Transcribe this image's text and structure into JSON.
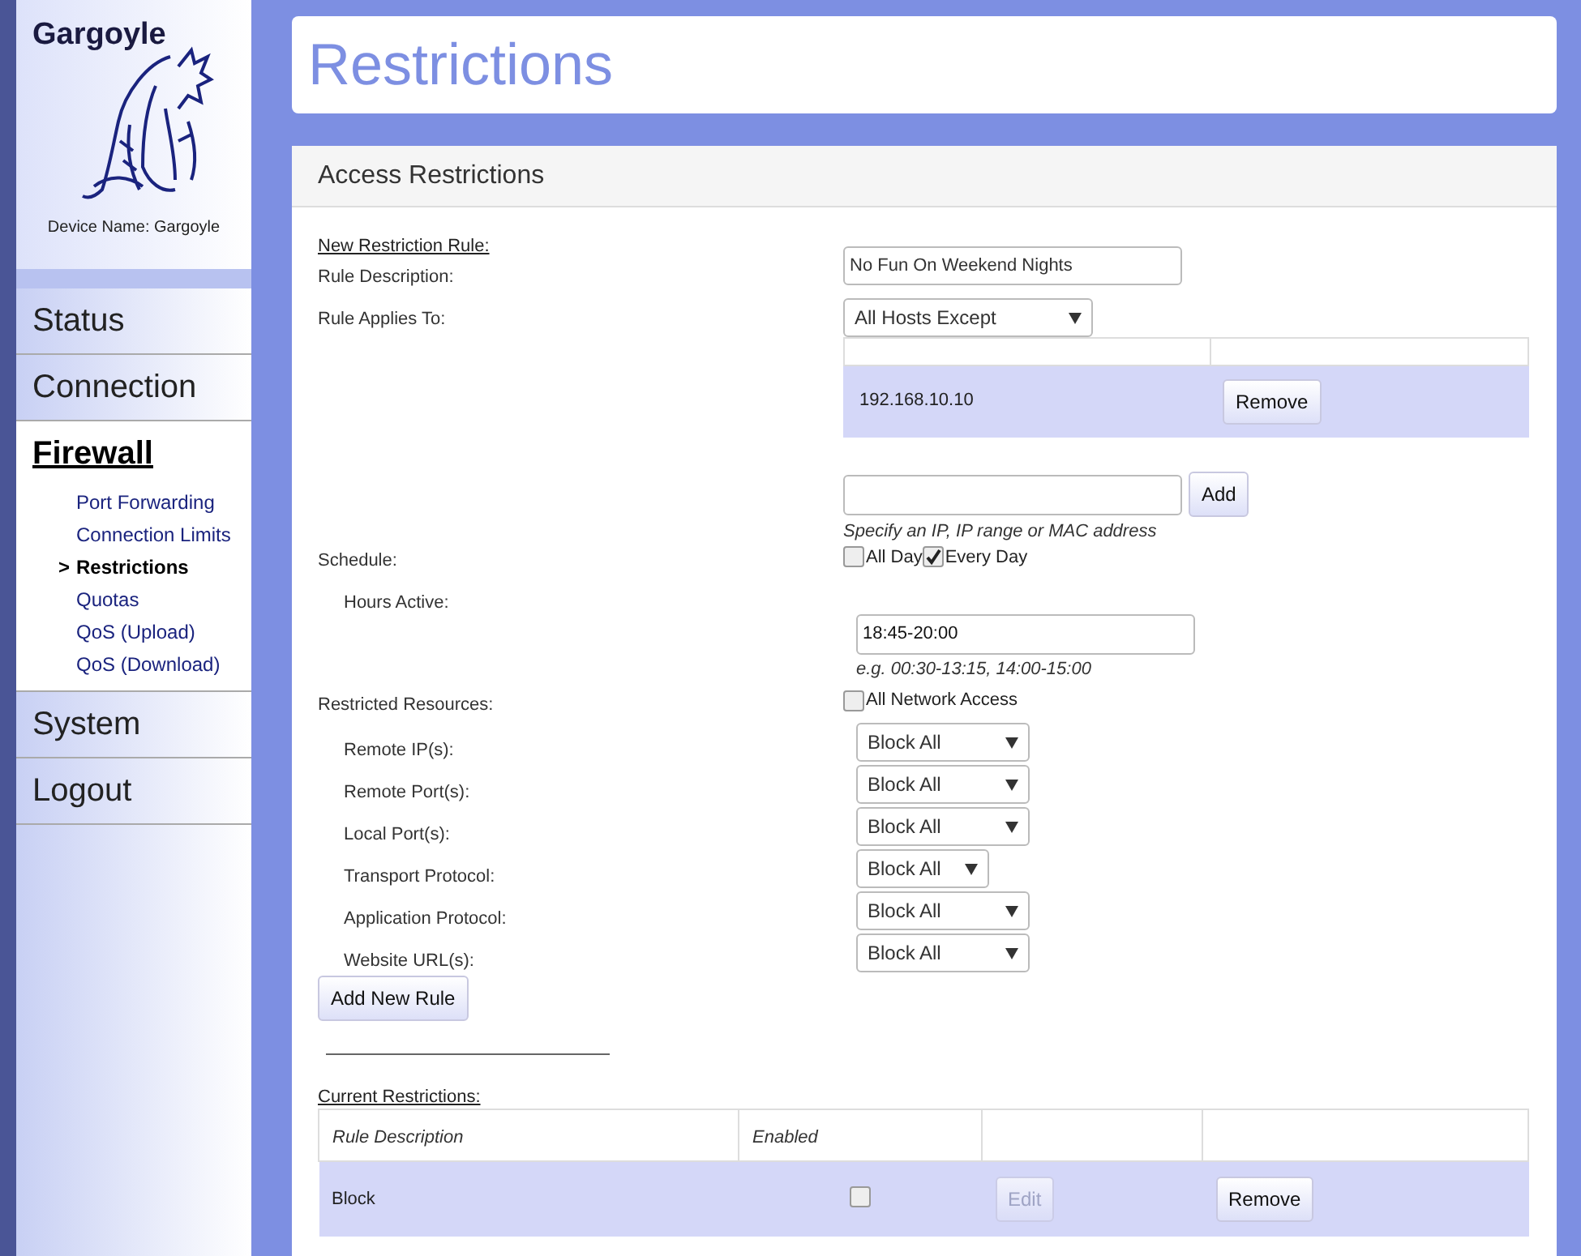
{
  "sidebar": {
    "title": "Gargoyle",
    "device_name": "Device Name: Gargoyle",
    "nav": [
      {
        "label": "Status",
        "selected": false
      },
      {
        "label": "Connection",
        "selected": false
      },
      {
        "label": "Firewall",
        "selected": true,
        "children": [
          {
            "label": "Port Forwarding",
            "selected": false
          },
          {
            "label": "Connection Limits",
            "selected": false
          },
          {
            "label": "Restrictions",
            "selected": true,
            "marker": ">"
          },
          {
            "label": "Quotas",
            "selected": false
          },
          {
            "label": "QoS (Upload)",
            "selected": false
          },
          {
            "label": "QoS (Download)",
            "selected": false
          }
        ]
      },
      {
        "label": "System",
        "selected": false
      },
      {
        "label": "Logout",
        "selected": false
      }
    ]
  },
  "page_title": "Restrictions",
  "panel": {
    "title": "Access Restrictions",
    "new_rule": {
      "heading": "New Restriction Rule:",
      "description_label": "Rule Description:",
      "description_value": "No Fun On Weekend Nights",
      "applies_label": "Rule Applies To:",
      "applies_value": "All Hosts Except",
      "hosts": [
        {
          "address": "192.168.10.10",
          "button": "Remove"
        }
      ],
      "add_button": "Add",
      "add_hint": "Specify an IP, IP range or MAC address",
      "schedule_label": "Schedule:",
      "schedule_options": [
        {
          "label": "All Day",
          "checked": false
        },
        {
          "label": "Every Day",
          "checked": true
        }
      ],
      "hours_label": "Hours Active:",
      "hours_value": "18:45-20:00",
      "hours_hint": "e.g. 00:30-13:15, 14:00-15:00",
      "resources_label": "Restricted Resources:",
      "all_network": {
        "label": "All Network Access",
        "checked": false
      },
      "resources": [
        {
          "label": "Remote IP(s):",
          "value": "Block All",
          "wide": true
        },
        {
          "label": "Remote Port(s):",
          "value": "Block All",
          "wide": true
        },
        {
          "label": "Local Port(s):",
          "value": "Block All",
          "wide": true
        },
        {
          "label": "Transport Protocol:",
          "value": "Block All",
          "wide": false
        },
        {
          "label": "Application Protocol:",
          "value": "Block All",
          "wide": true
        },
        {
          "label": "Website URL(s):",
          "value": "Block All",
          "wide": true
        }
      ],
      "submit": "Add New Rule"
    },
    "current": {
      "heading": "Current Restrictions:",
      "columns": [
        "Rule Description",
        "Enabled"
      ],
      "rows": [
        {
          "description": "Block",
          "enabled": false,
          "edit": "Edit",
          "edit_disabled": true,
          "remove": "Remove"
        }
      ]
    }
  }
}
